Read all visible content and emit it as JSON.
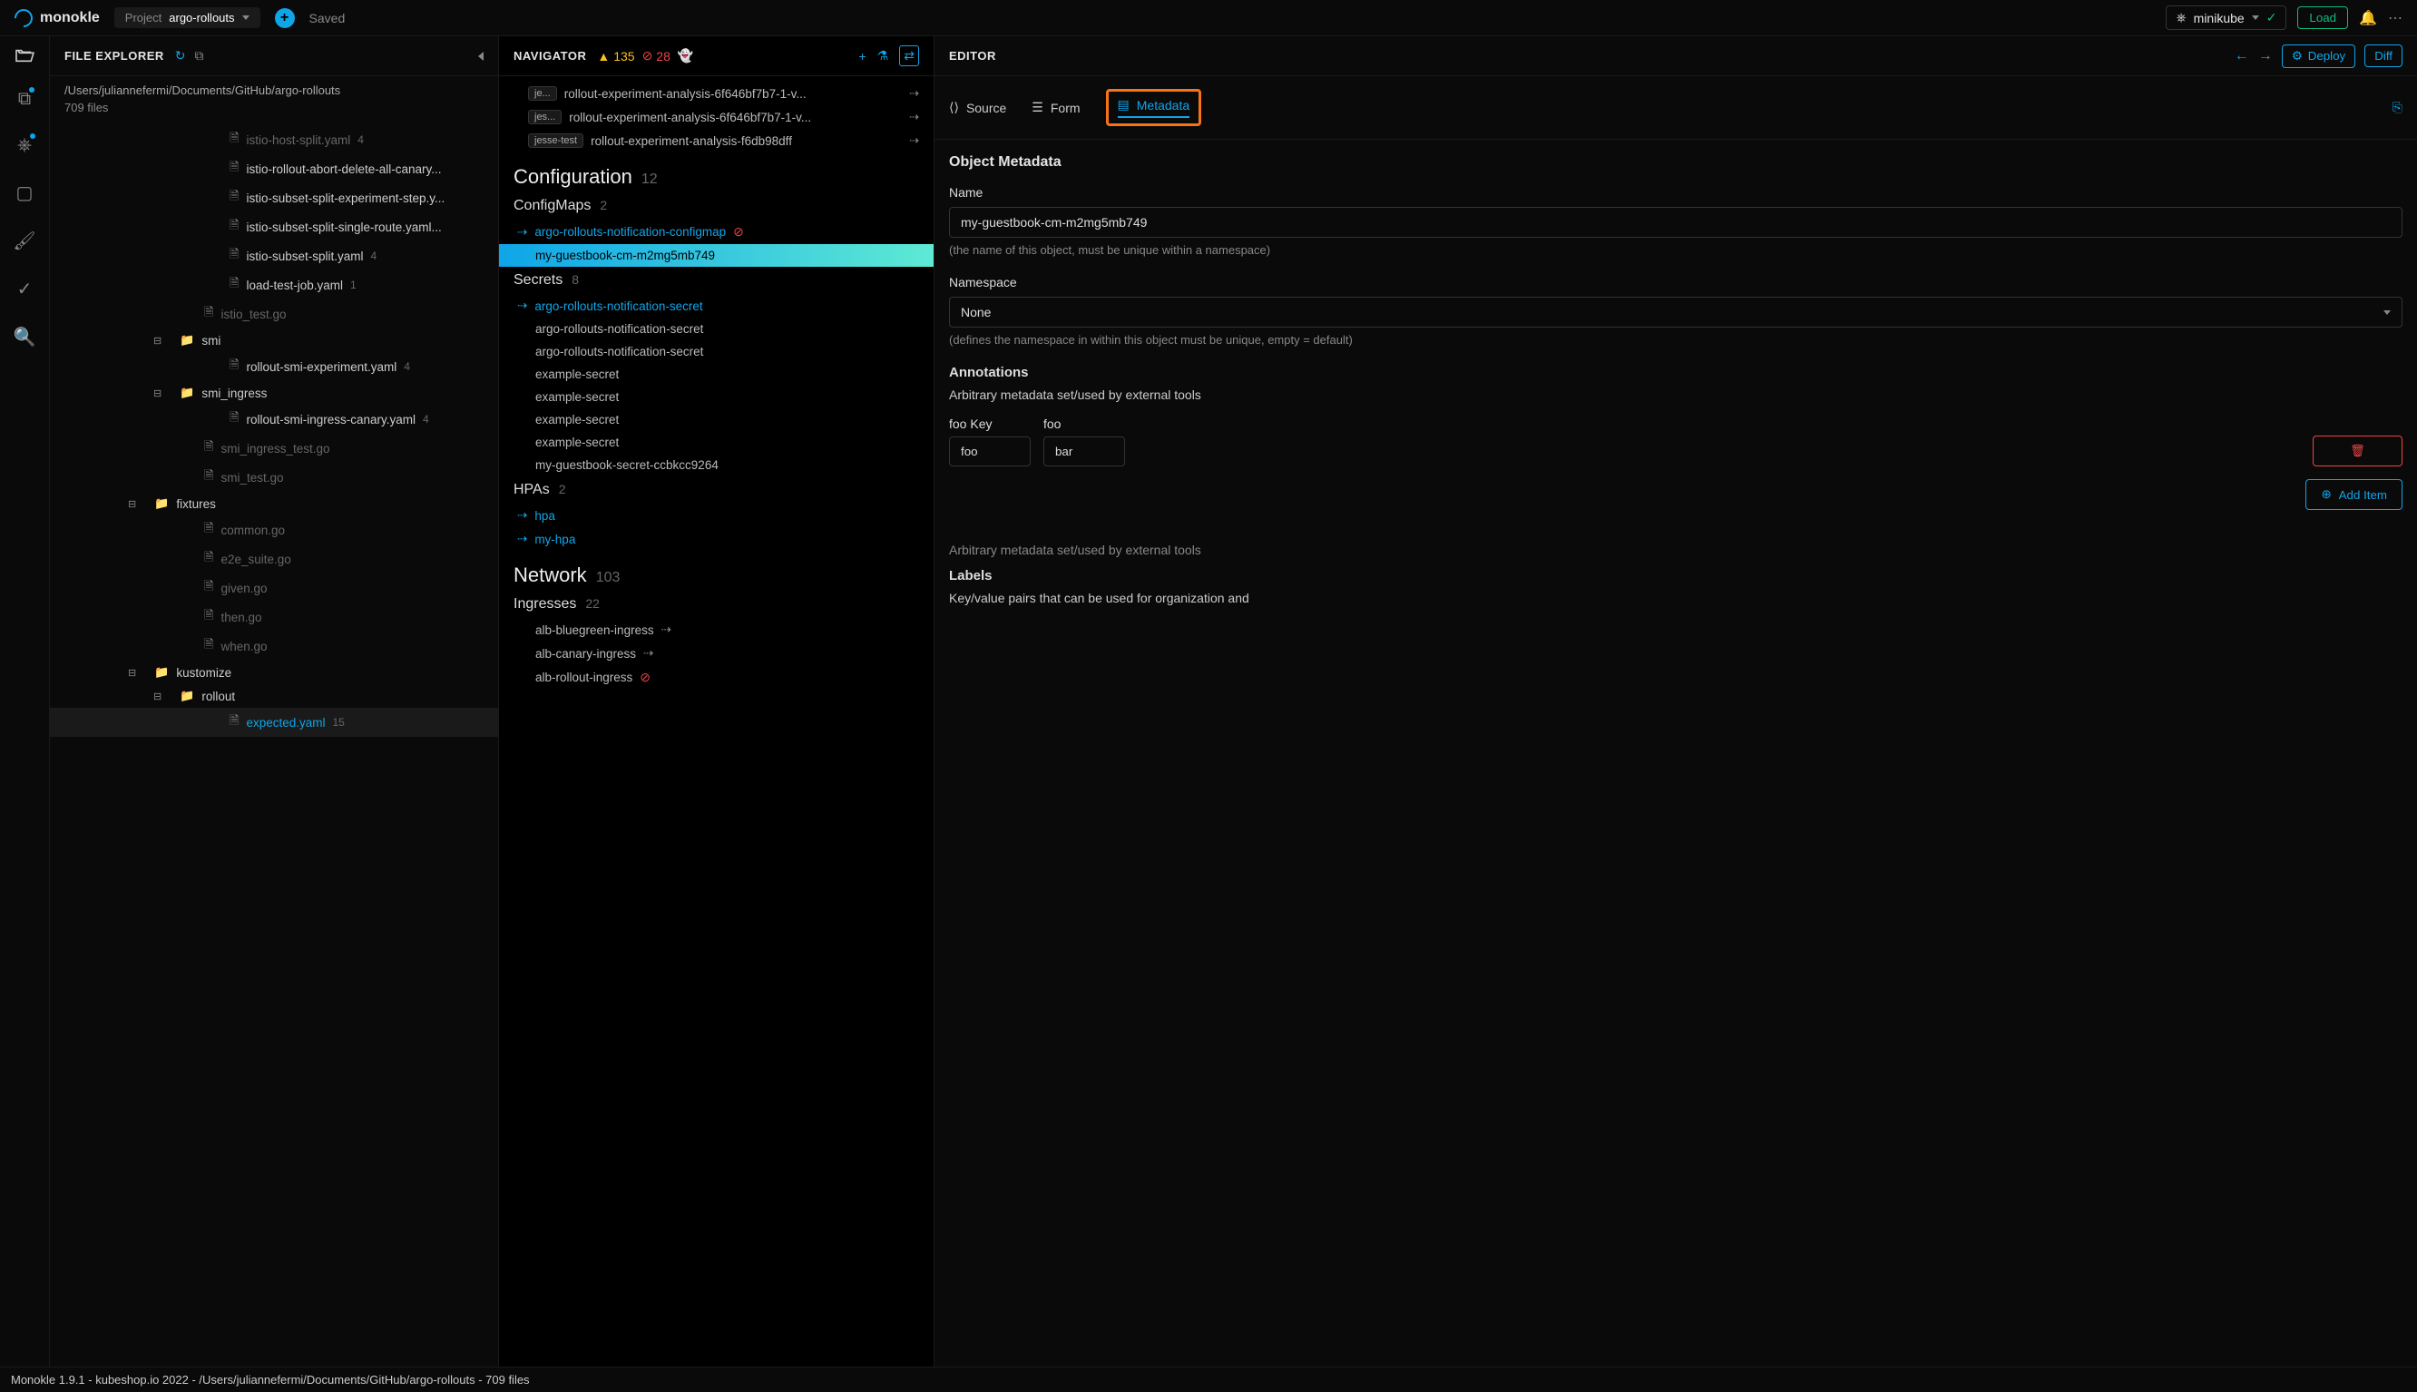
{
  "titlebar": {
    "logo_text": "monokle",
    "project_label": "Project",
    "project_name": "argo-rollouts",
    "saved": "Saved",
    "cluster_name": "minikube",
    "load_btn": "Load"
  },
  "file_explorer": {
    "title": "FILE EXPLORER",
    "path": "/Users/juliannefermi/Documents/GitHub/argo-rollouts",
    "file_count": "709 files",
    "tree": [
      {
        "indent": 190,
        "type": "file",
        "label": "istio-host-split.yaml",
        "dim": true,
        "count": "4"
      },
      {
        "indent": 190,
        "type": "file",
        "label": "istio-rollout-abort-delete-all-canary...",
        "count": ""
      },
      {
        "indent": 190,
        "type": "file",
        "label": "istio-subset-split-experiment-step.y...",
        "count": ""
      },
      {
        "indent": 190,
        "type": "file",
        "label": "istio-subset-split-single-route.yaml...",
        "count": ""
      },
      {
        "indent": 190,
        "type": "file",
        "label": "istio-subset-split.yaml",
        "count": "4"
      },
      {
        "indent": 190,
        "type": "file",
        "label": "load-test-job.yaml",
        "count": "1"
      },
      {
        "indent": 162,
        "type": "file",
        "label": "istio_test.go",
        "dim": true
      },
      {
        "indent": 134,
        "type": "folder",
        "label": "smi",
        "toggle": true
      },
      {
        "indent": 190,
        "type": "file",
        "label": "rollout-smi-experiment.yaml",
        "count": "4"
      },
      {
        "indent": 134,
        "type": "folder",
        "label": "smi_ingress",
        "toggle": true
      },
      {
        "indent": 190,
        "type": "file",
        "label": "rollout-smi-ingress-canary.yaml",
        "count": "4"
      },
      {
        "indent": 162,
        "type": "file",
        "label": "smi_ingress_test.go",
        "dim": true
      },
      {
        "indent": 162,
        "type": "file",
        "label": "smi_test.go",
        "dim": true
      },
      {
        "indent": 106,
        "type": "folder",
        "label": "fixtures",
        "toggle": true
      },
      {
        "indent": 162,
        "type": "file",
        "label": "common.go",
        "dim": true
      },
      {
        "indent": 162,
        "type": "file",
        "label": "e2e_suite.go",
        "dim": true
      },
      {
        "indent": 162,
        "type": "file",
        "label": "given.go",
        "dim": true
      },
      {
        "indent": 162,
        "type": "file",
        "label": "then.go",
        "dim": true
      },
      {
        "indent": 162,
        "type": "file",
        "label": "when.go",
        "dim": true
      },
      {
        "indent": 106,
        "type": "folder",
        "label": "kustomize",
        "toggle": true
      },
      {
        "indent": 134,
        "type": "folder",
        "label": "rollout",
        "toggle": true
      },
      {
        "indent": 190,
        "type": "file",
        "label": "expected.yaml",
        "count": "15",
        "highlight": true,
        "selected": true
      }
    ]
  },
  "navigator": {
    "title": "NAVIGATOR",
    "warn_count": "135",
    "err_count": "28",
    "top_items": [
      {
        "badge": "je...",
        "label": "rollout-experiment-analysis-6f646bf7b7-1-v...",
        "share": true
      },
      {
        "badge": "jes...",
        "label": "rollout-experiment-analysis-6f646bf7b7-1-v...",
        "share": true
      },
      {
        "badge": "jesse-test",
        "label": "rollout-experiment-analysis-f6db98dff",
        "share": true
      }
    ],
    "sections": [
      {
        "title": "Configuration",
        "count": "12",
        "groups": [
          {
            "title": "ConfigMaps",
            "count": "2",
            "items": [
              {
                "label": "argo-rollouts-notification-configmap",
                "link": true,
                "share_prefix": true,
                "error": true
              },
              {
                "label": "my-guestbook-cm-m2mg5mb749",
                "selected": true,
                "indent": true
              }
            ]
          },
          {
            "title": "Secrets",
            "count": "8",
            "items": [
              {
                "label": "argo-rollouts-notification-secret",
                "link": true,
                "share_prefix": true
              },
              {
                "label": "argo-rollouts-notification-secret",
                "indent": true
              },
              {
                "label": "argo-rollouts-notification-secret",
                "indent": true
              },
              {
                "label": "example-secret",
                "indent": true
              },
              {
                "label": "example-secret",
                "indent": true
              },
              {
                "label": "example-secret",
                "indent": true
              },
              {
                "label": "example-secret",
                "indent": true
              },
              {
                "label": "my-guestbook-secret-ccbkcc9264",
                "indent": true
              }
            ]
          },
          {
            "title": "HPAs",
            "count": "2",
            "items": [
              {
                "label": "hpa",
                "link": true,
                "share_prefix": true
              },
              {
                "label": "my-hpa",
                "link": true,
                "share_prefix": true
              }
            ]
          }
        ]
      },
      {
        "title": "Network",
        "count": "103",
        "groups": [
          {
            "title": "Ingresses",
            "count": "22",
            "items": [
              {
                "label": "alb-bluegreen-ingress",
                "indent": true,
                "share": true
              },
              {
                "label": "alb-canary-ingress",
                "indent": true,
                "share": true
              },
              {
                "label": "alb-rollout-ingress",
                "indent": true,
                "error": true
              }
            ]
          }
        ]
      }
    ]
  },
  "editor": {
    "title": "EDITOR",
    "deploy": "Deploy",
    "diff": "Diff",
    "tabs": {
      "source": "Source",
      "form": "Form",
      "metadata": "Metadata"
    },
    "metadata": {
      "section_title": "Object Metadata",
      "name_label": "Name",
      "name_value": "my-guestbook-cm-m2mg5mb749",
      "name_help": "(the name of this object, must be unique within a namespace)",
      "namespace_label": "Namespace",
      "namespace_value": "None",
      "namespace_help": "(defines the namespace in within this object must be unique, empty = default)",
      "annotations_label": "Annotations",
      "annotations_desc": "Arbitrary metadata set/used by external tools",
      "anno_key_label": "foo Key",
      "anno_val_label": "foo",
      "anno_key_value": "foo",
      "anno_val_value": "bar",
      "add_item": "Add Item",
      "labels_desc_repeat": "Arbitrary metadata set/used by external tools",
      "labels_label": "Labels",
      "labels_desc": "Key/value pairs that can be used for organization and"
    }
  },
  "statusbar": "Monokle 1.9.1 - kubeshop.io 2022 - /Users/juliannefermi/Documents/GitHub/argo-rollouts - 709 files"
}
